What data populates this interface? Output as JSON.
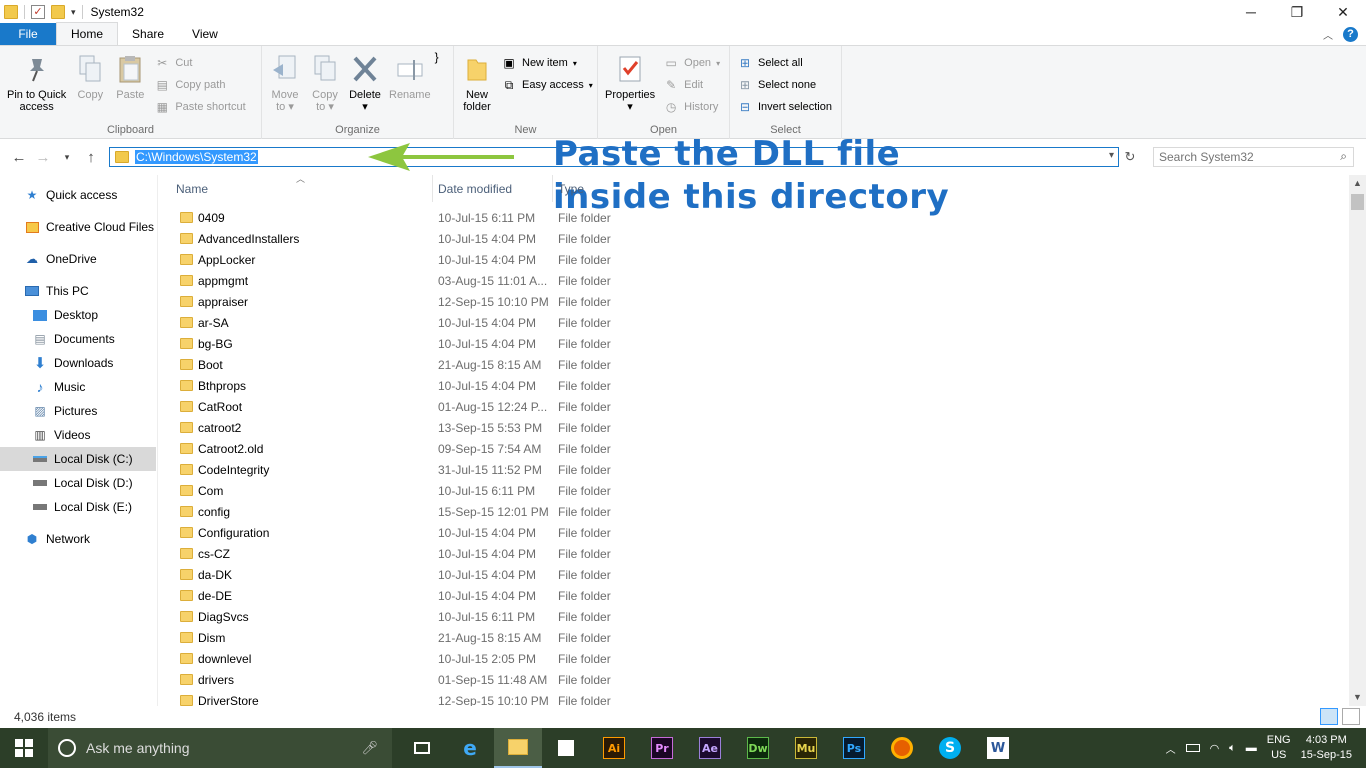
{
  "titlebar": {
    "title": "System32"
  },
  "tabs": {
    "file": "File",
    "home": "Home",
    "share": "Share",
    "view": "View"
  },
  "ribbon": {
    "clipboard": {
      "label": "Clipboard",
      "pin_line1": "Pin to Quick",
      "pin_line2": "access",
      "copy": "Copy",
      "paste": "Paste",
      "cut": "Cut",
      "copy_path": "Copy path",
      "paste_shortcut": "Paste shortcut"
    },
    "organize": {
      "label": "Organize",
      "move_line1": "Move",
      "move_line2": "to",
      "copy_line1": "Copy",
      "copy_line2": "to",
      "delete": "Delete",
      "rename": "Rename"
    },
    "new": {
      "label": "New",
      "new_folder_line1": "New",
      "new_folder_line2": "folder",
      "new_item": "New item",
      "easy_access": "Easy access"
    },
    "open": {
      "label": "Open",
      "properties": "Properties",
      "open": "Open",
      "edit": "Edit",
      "history": "History"
    },
    "select": {
      "label": "Select",
      "select_all": "Select all",
      "select_none": "Select none",
      "invert": "Invert selection"
    }
  },
  "address": {
    "path": "C:\\Windows\\System32"
  },
  "search": {
    "placeholder": "Search System32"
  },
  "annotation": {
    "line1": "Paste the DLL file",
    "line2": "inside this directory"
  },
  "nav": {
    "quick_access": "Quick access",
    "creative_cloud": "Creative Cloud Files",
    "onedrive": "OneDrive",
    "this_pc": "This PC",
    "desktop": "Desktop",
    "documents": "Documents",
    "downloads": "Downloads",
    "music": "Music",
    "pictures": "Pictures",
    "videos": "Videos",
    "disk_c": "Local Disk (C:)",
    "disk_d": "Local Disk (D:)",
    "disk_e": "Local Disk (E:)",
    "network": "Network"
  },
  "columns": {
    "name": "Name",
    "date": "Date modified",
    "type": "Type"
  },
  "files": [
    {
      "name": "0409",
      "date": "10-Jul-15 6:11 PM",
      "type": "File folder"
    },
    {
      "name": "AdvancedInstallers",
      "date": "10-Jul-15 4:04 PM",
      "type": "File folder"
    },
    {
      "name": "AppLocker",
      "date": "10-Jul-15 4:04 PM",
      "type": "File folder"
    },
    {
      "name": "appmgmt",
      "date": "03-Aug-15 11:01 A...",
      "type": "File folder"
    },
    {
      "name": "appraiser",
      "date": "12-Sep-15 10:10 PM",
      "type": "File folder"
    },
    {
      "name": "ar-SA",
      "date": "10-Jul-15 4:04 PM",
      "type": "File folder"
    },
    {
      "name": "bg-BG",
      "date": "10-Jul-15 4:04 PM",
      "type": "File folder"
    },
    {
      "name": "Boot",
      "date": "21-Aug-15 8:15 AM",
      "type": "File folder"
    },
    {
      "name": "Bthprops",
      "date": "10-Jul-15 4:04 PM",
      "type": "File folder"
    },
    {
      "name": "CatRoot",
      "date": "01-Aug-15 12:24 P...",
      "type": "File folder"
    },
    {
      "name": "catroot2",
      "date": "13-Sep-15 5:53 PM",
      "type": "File folder"
    },
    {
      "name": "Catroot2.old",
      "date": "09-Sep-15 7:54 AM",
      "type": "File folder"
    },
    {
      "name": "CodeIntegrity",
      "date": "31-Jul-15 11:52 PM",
      "type": "File folder"
    },
    {
      "name": "Com",
      "date": "10-Jul-15 6:11 PM",
      "type": "File folder"
    },
    {
      "name": "config",
      "date": "15-Sep-15 12:01 PM",
      "type": "File folder"
    },
    {
      "name": "Configuration",
      "date": "10-Jul-15 4:04 PM",
      "type": "File folder"
    },
    {
      "name": "cs-CZ",
      "date": "10-Jul-15 4:04 PM",
      "type": "File folder"
    },
    {
      "name": "da-DK",
      "date": "10-Jul-15 4:04 PM",
      "type": "File folder"
    },
    {
      "name": "de-DE",
      "date": "10-Jul-15 4:04 PM",
      "type": "File folder"
    },
    {
      "name": "DiagSvcs",
      "date": "10-Jul-15 6:11 PM",
      "type": "File folder"
    },
    {
      "name": "Dism",
      "date": "21-Aug-15 8:15 AM",
      "type": "File folder"
    },
    {
      "name": "downlevel",
      "date": "10-Jul-15 2:05 PM",
      "type": "File folder"
    },
    {
      "name": "drivers",
      "date": "01-Sep-15 11:48 AM",
      "type": "File folder"
    },
    {
      "name": "DriverStore",
      "date": "12-Sep-15 10:10 PM",
      "type": "File folder"
    }
  ],
  "status": {
    "count": "4,036 items"
  },
  "taskbar": {
    "search_placeholder": "Ask me anything",
    "apps": [
      "Ai",
      "Pr",
      "Ae",
      "Dw",
      "Mu",
      "Ps"
    ],
    "lang_line1": "ENG",
    "lang_line2": "US",
    "time": "4:03 PM",
    "date": "15-Sep-15"
  },
  "colors": {
    "accent": "#1979ca",
    "annotation": "#1f6fc4",
    "arrow": "#8dc63f",
    "taskbar": "#2c3e28"
  }
}
